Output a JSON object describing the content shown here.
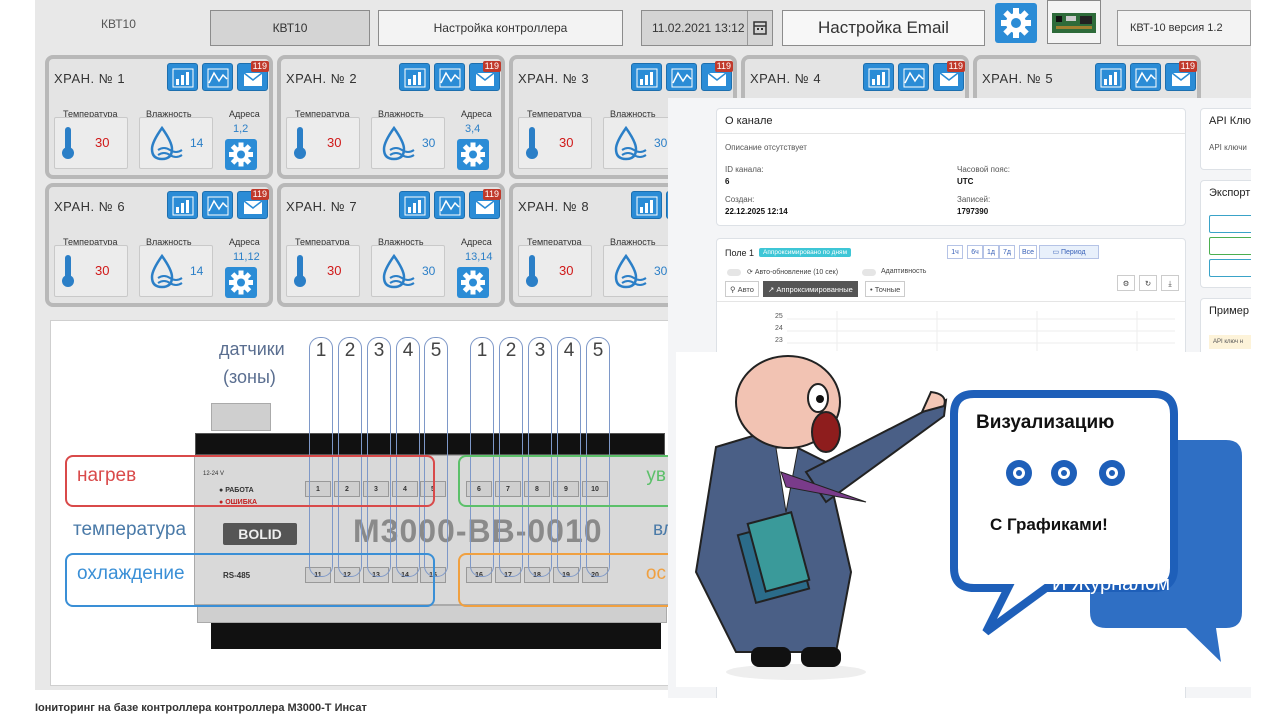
{
  "header": {
    "left_label": "КВТ10",
    "name_box": "КВТ10",
    "title_box": "Настройка контроллера",
    "datetime": "11.02.2021 13:12",
    "email_button": "Настройка Email",
    "version": "КВТ-10 версия 1.2"
  },
  "labels": {
    "temperature": "Температура",
    "humidity": "Влажность",
    "addresses": "Адреса"
  },
  "cards": [
    {
      "title": "ХРАН. № 1",
      "temp": "30",
      "hum": "14",
      "addr": "1,2",
      "badge": "119"
    },
    {
      "title": "ХРАН. № 2",
      "temp": "30",
      "hum": "30",
      "addr": "3,4",
      "badge": "119"
    },
    {
      "title": "ХРАН. № 3",
      "temp": "30",
      "hum": "30",
      "addr": "",
      "badge": "119"
    },
    {
      "title": "ХРАН. № 4",
      "temp": "",
      "hum": "",
      "addr": "",
      "badge": "119"
    },
    {
      "title": "ХРАН. № 5",
      "temp": "",
      "hum": "",
      "addr": "",
      "badge": "119"
    },
    {
      "title": "ХРАН. № 6",
      "temp": "30",
      "hum": "14",
      "addr": "11,12",
      "badge": "119"
    },
    {
      "title": "ХРАН. № 7",
      "temp": "30",
      "hum": "30",
      "addr": "13,14",
      "badge": "119"
    },
    {
      "title": "ХРАН. № 8",
      "temp": "30",
      "hum": "30",
      "addr": "",
      "badge": ""
    }
  ],
  "diagram": {
    "sensors_label_1": "датчики",
    "sensors_label_2": "(зоны)",
    "zone_numbers": [
      "1",
      "2",
      "3",
      "4",
      "5",
      "1",
      "2",
      "3",
      "4",
      "5"
    ],
    "heating": "нагрев",
    "temperature": "температура",
    "cooling": "охлаждение",
    "right_1": "ув",
    "right_2": "вл",
    "right_3": "ос",
    "device_model": "M3000-BB-0010",
    "brand": "BOLID",
    "status_work": "РАБОТА",
    "status_error": "ОШИБКА",
    "power": "12-24 V",
    "bus": "RS-485",
    "top_terminals": [
      "1",
      "2",
      "3",
      "4",
      "5",
      "6",
      "7",
      "8",
      "9",
      "10"
    ],
    "bottom_terminals": [
      "11",
      "12",
      "13",
      "14",
      "15",
      "16",
      "17",
      "18",
      "19",
      "20"
    ]
  },
  "web": {
    "about_title": "О канале",
    "description": "Описание отсутствует",
    "id_label": "ID канала:",
    "id_value": "6",
    "tz_label": "Часовой пояс:",
    "tz_value": "UTC",
    "created_label": "Создан:",
    "created_value": "22.12.2025 12:14",
    "records_label": "Записей:",
    "records_value": "1797390",
    "api_title": "API Клю",
    "api_keys": "API ключи",
    "export_title": "Экспорт",
    "examples_title": "Пример",
    "api_key_chip": "API ключ н",
    "field_title": "Поле 1",
    "approx_badge": "Аппроксимировано по дням",
    "ranges": [
      "1ч",
      "6ч",
      "1д",
      "7д",
      "Все"
    ],
    "period": "Период",
    "auto_update": "Авто-обновление (10 сек)",
    "adaptive": "Адаптивность",
    "mode_auto": "Авто",
    "mode_approx": "Аппроксимированные",
    "mode_exact": "Точные",
    "y_ticks": [
      "25",
      "24",
      "23"
    ],
    "bottom_tick": "24"
  },
  "bubble": {
    "line1": "Визуализацию",
    "line2": "С Графиками!",
    "line3": "И Журналом"
  },
  "caption": "Іониторинг на базе контроллера контроллера М3000-Т Инсат",
  "colors": {
    "icon_blue": "#2b8cd6",
    "value_red": "#d01818",
    "bubble_blue": "#1e5fb9",
    "bubble_back": "#2f6fc4",
    "heating_red": "#d94a4a",
    "cooling_blue": "#3a8fd6",
    "green": "#5cc06a",
    "orange": "#f0a040"
  }
}
